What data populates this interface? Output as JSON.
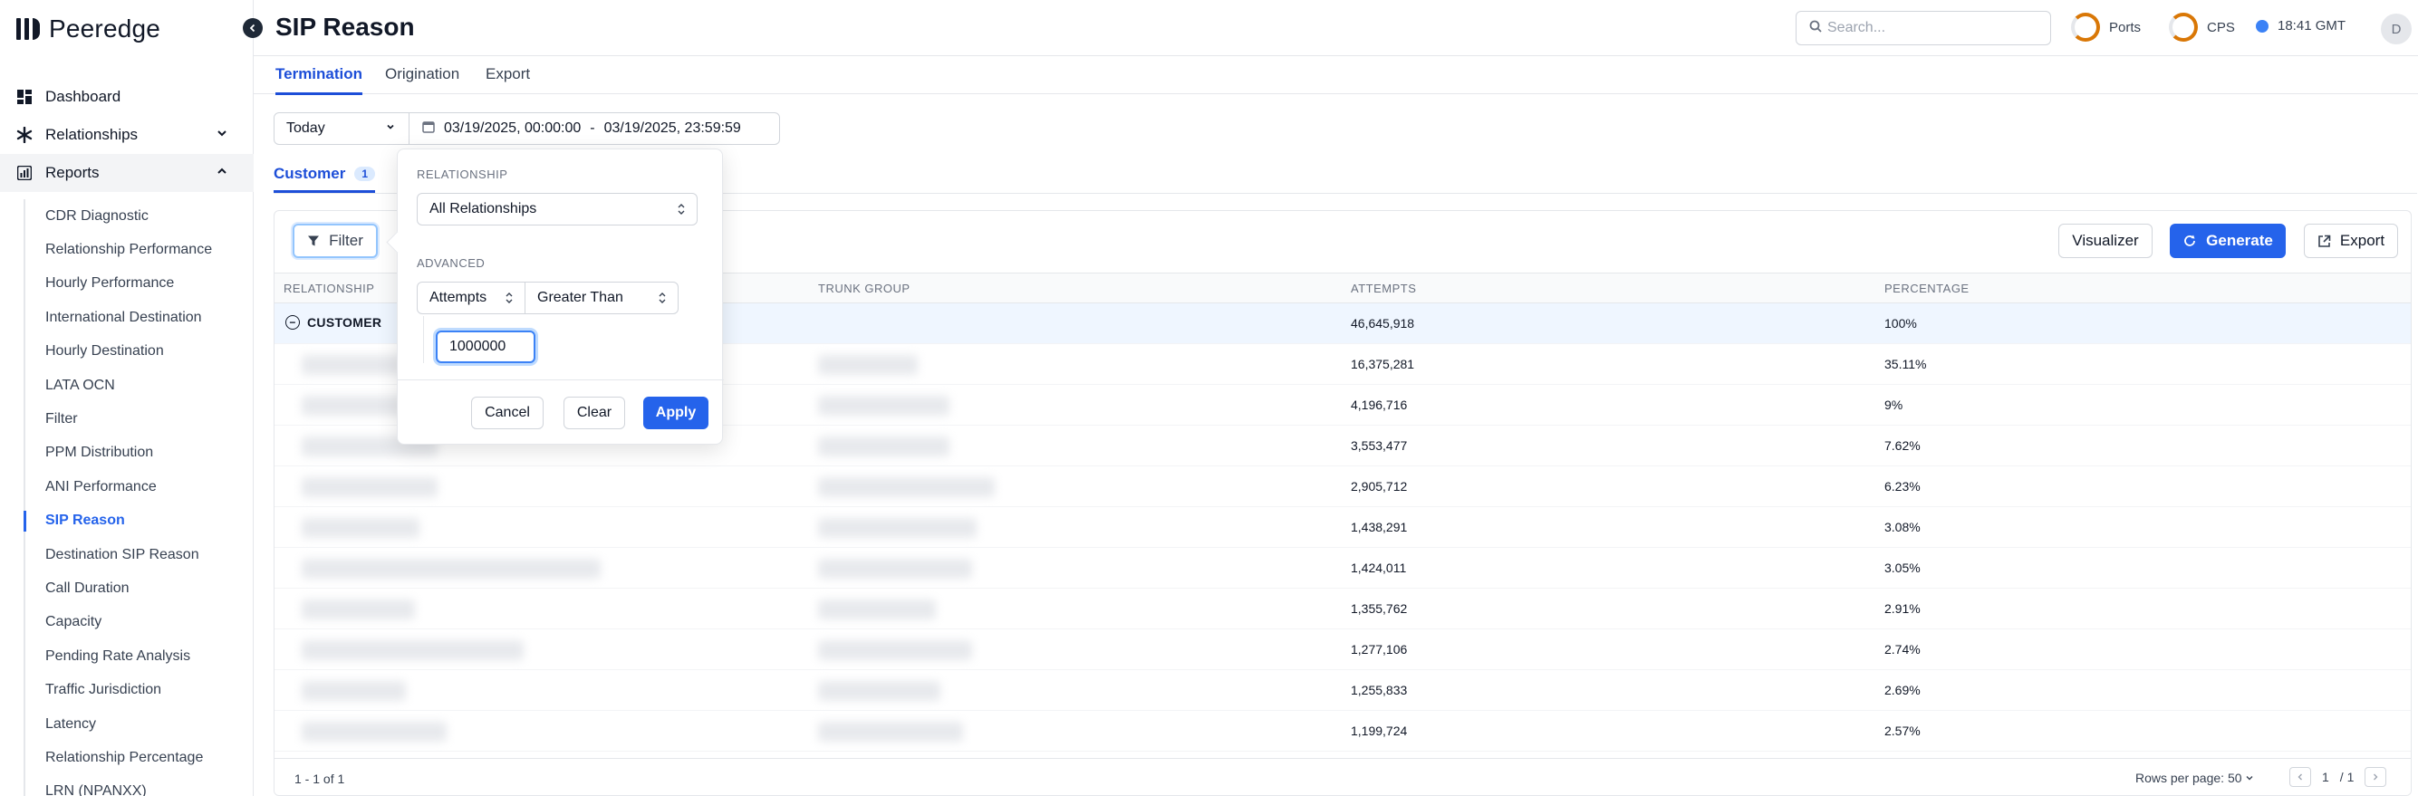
{
  "brand": {
    "name": "Peeredge"
  },
  "sidebar": {
    "nav": [
      {
        "label": "Dashboard"
      },
      {
        "label": "Relationships"
      },
      {
        "label": "Reports"
      }
    ],
    "reports": [
      "CDR Diagnostic",
      "Relationship Performance",
      "Hourly Performance",
      "International Destination",
      "Hourly Destination",
      "LATA OCN",
      "Filter",
      "PPM Distribution",
      "ANI Performance",
      "SIP Reason",
      "Destination SIP Reason",
      "Call Duration",
      "Capacity",
      "Pending Rate Analysis",
      "Traffic Jurisdiction",
      "Latency",
      "Relationship Percentage",
      "LRN (NPANXX)"
    ],
    "active_report": "SIP Reason"
  },
  "header": {
    "title": "SIP Reason",
    "search_placeholder": "Search...",
    "ports_label": "Ports",
    "cps_label": "CPS",
    "time": "18:41 GMT",
    "avatar_initial": "D"
  },
  "tabs": [
    "Termination",
    "Origination",
    "Export"
  ],
  "date": {
    "range": "Today",
    "start": "03/19/2025, 00:00:00",
    "separator": "-",
    "end": "03/19/2025, 23:59:59"
  },
  "subtab": {
    "label": "Customer",
    "count": "1"
  },
  "toolbar": {
    "filter_label": "Filter",
    "visualizer_label": "Visualizer",
    "generate_label": "Generate",
    "export_label": "Export"
  },
  "table": {
    "columns": [
      "Relationship",
      "Trunk Group",
      "Attempts",
      "Percentage"
    ],
    "group": {
      "label": "CUSTOMER",
      "attempts": "46,645,918",
      "percentage": "100%"
    },
    "rows": [
      {
        "attempts": "16,375,281",
        "percentage": "35.11%"
      },
      {
        "attempts": "4,196,716",
        "percentage": "9%"
      },
      {
        "attempts": "3,553,477",
        "percentage": "7.62%"
      },
      {
        "attempts": "2,905,712",
        "percentage": "6.23%"
      },
      {
        "attempts": "1,438,291",
        "percentage": "3.08%"
      },
      {
        "attempts": "1,424,011",
        "percentage": "3.05%"
      },
      {
        "attempts": "1,355,762",
        "percentage": "2.91%"
      },
      {
        "attempts": "1,277,106",
        "percentage": "2.74%"
      },
      {
        "attempts": "1,255,833",
        "percentage": "2.69%"
      },
      {
        "attempts": "1,199,724",
        "percentage": "2.57%"
      }
    ]
  },
  "footer": {
    "range_text": "1 - 1 of 1",
    "rows_per_page": "Rows per page: 50",
    "page": "1",
    "total_pages": "/ 1"
  },
  "filter_popover": {
    "relationship_label": "Relationship",
    "relationship_value": "All Relationships",
    "advanced_label": "Advanced",
    "field_value": "Attempts",
    "operator_value": "Greater Than",
    "threshold_value": "1000000",
    "cancel_label": "Cancel",
    "clear_label": "Clear",
    "apply_label": "Apply"
  },
  "colors": {
    "accent": "#2563eb",
    "gauge": "#d97706"
  }
}
